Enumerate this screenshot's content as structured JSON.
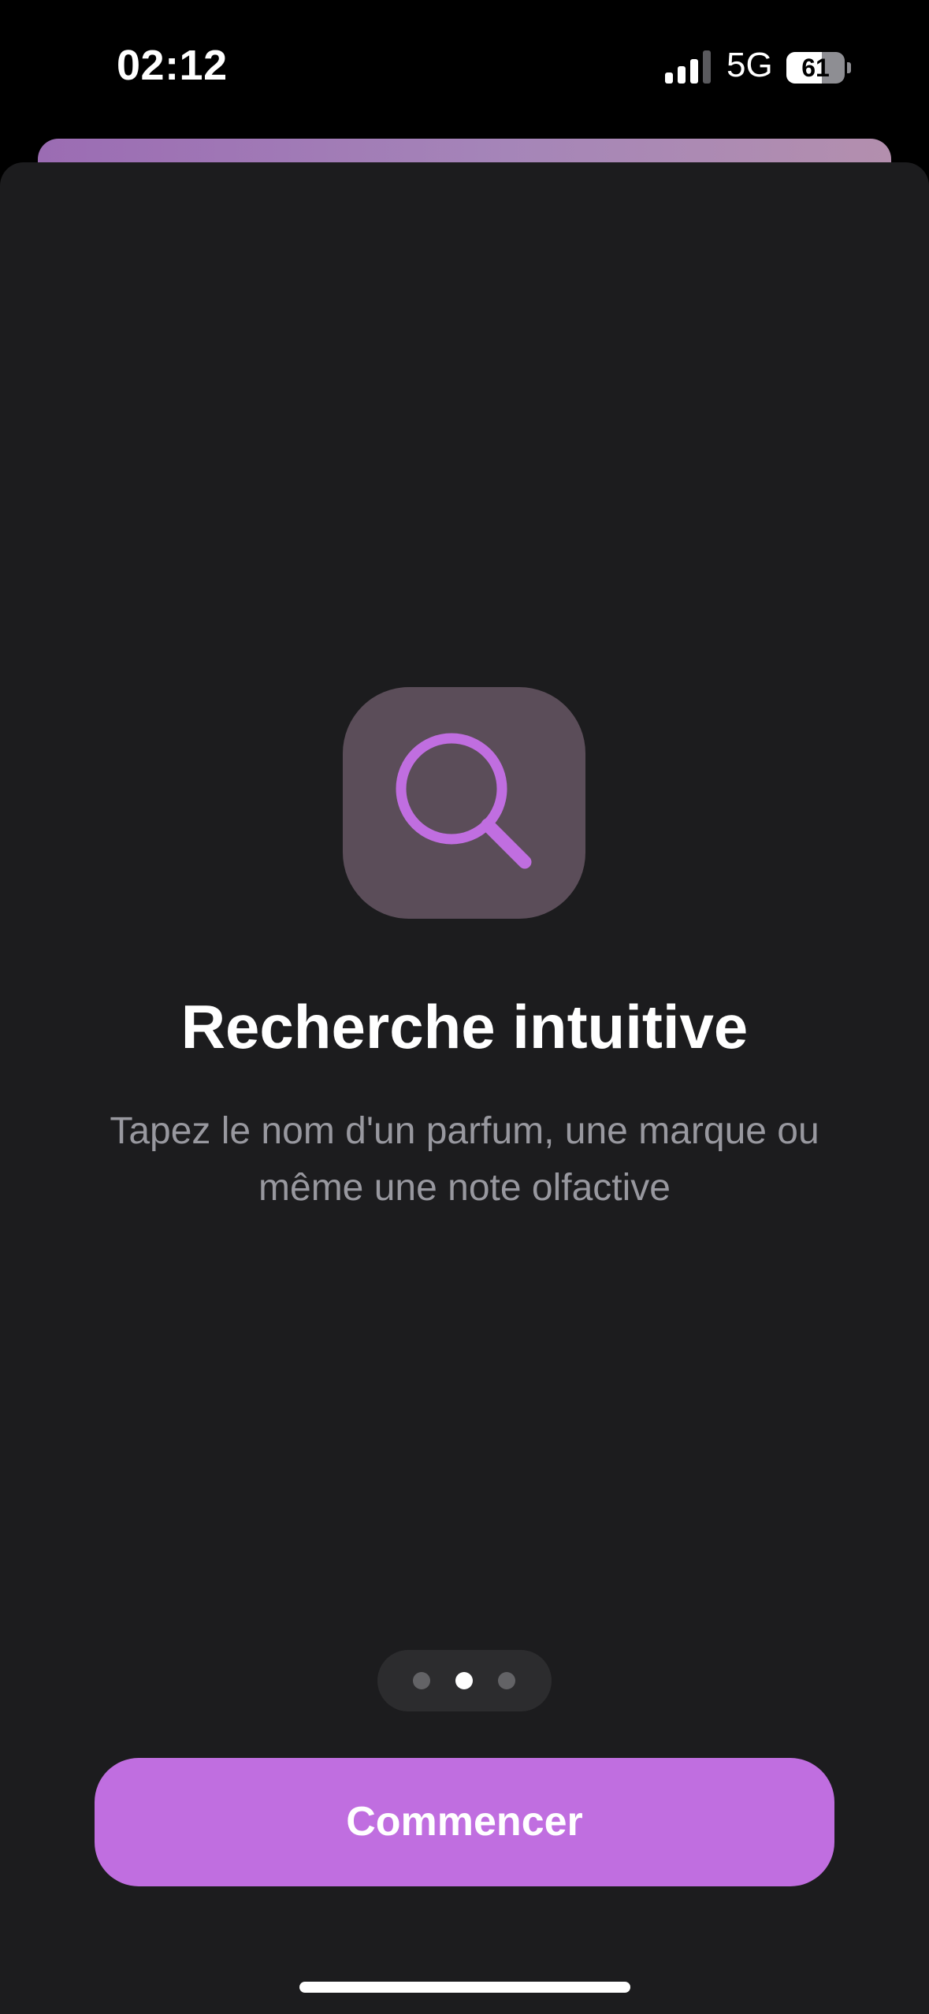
{
  "status_bar": {
    "time": "02:12",
    "network": "5G",
    "battery_level": "61",
    "signal_bars_active": 3
  },
  "onboarding": {
    "feature_icon": "magnifying-glass-icon",
    "title": "Recherche intuitive",
    "description": "Tapez le nom d'un parfum, une marque ou même une note olfactive",
    "page_count": 3,
    "current_page": 2,
    "cta_label": "Commencer"
  },
  "colors": {
    "accent": "#c06ee0",
    "sheet_background": "#1c1c1e",
    "icon_tile": "#5b4d59",
    "secondary_text": "#98989f"
  }
}
